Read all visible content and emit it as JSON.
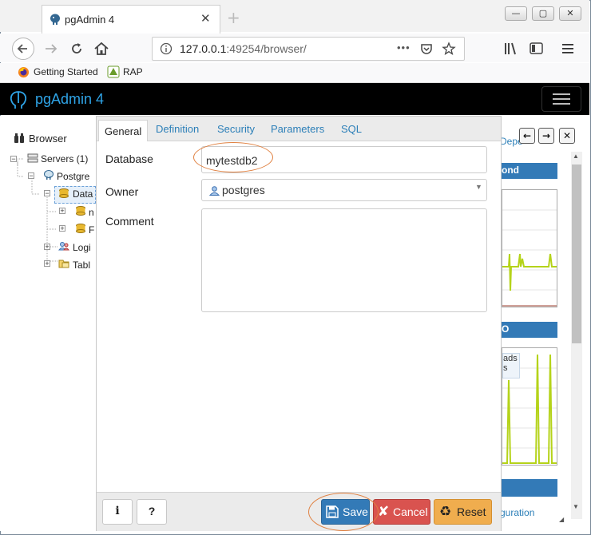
{
  "browser": {
    "tab_title": "pgAdmin 4",
    "tab_close": "✕",
    "new_tab": "+",
    "url_host": "127.0.0.1",
    "url_rest": ":49254/browser/",
    "url_ellipsis": "•••",
    "bookmarks": [
      {
        "label": "Getting Started"
      },
      {
        "label": "RAP"
      }
    ]
  },
  "pgadmin": {
    "title": "pgAdmin 4"
  },
  "browser_panel": {
    "label": "Browser",
    "tree": [
      {
        "label": "Servers (1)"
      },
      {
        "label": "Postgre"
      },
      {
        "label": "Data"
      },
      {
        "label": "n"
      },
      {
        "label": "F"
      },
      {
        "label": "Logi"
      },
      {
        "label": "Tabl"
      }
    ]
  },
  "dialog": {
    "tabs": [
      "General",
      "Definition",
      "Security",
      "Parameters",
      "SQL"
    ],
    "fields": {
      "database_label": "Database",
      "database_value": "mytestdb2",
      "owner_label": "Owner",
      "owner_value": "postgres",
      "comment_label": "Comment",
      "comment_value": ""
    },
    "footer": {
      "info": "i",
      "help": "?",
      "save": "Save",
      "cancel": "Cancel",
      "reset": "Reset"
    }
  },
  "dashboard": {
    "tab_partial": "Depe",
    "panel1_title": "ond",
    "panel2_title": "O",
    "legend_partial_1": "ads",
    "legend_partial_2": "s",
    "bottom_link": "guration"
  },
  "colors": {
    "accent": "#2fa4e7",
    "save": "#337ab7",
    "cancel": "#d9534f",
    "reset": "#f0ad4e",
    "chart_line": "#b5d31a",
    "highlight": "#e08040"
  }
}
